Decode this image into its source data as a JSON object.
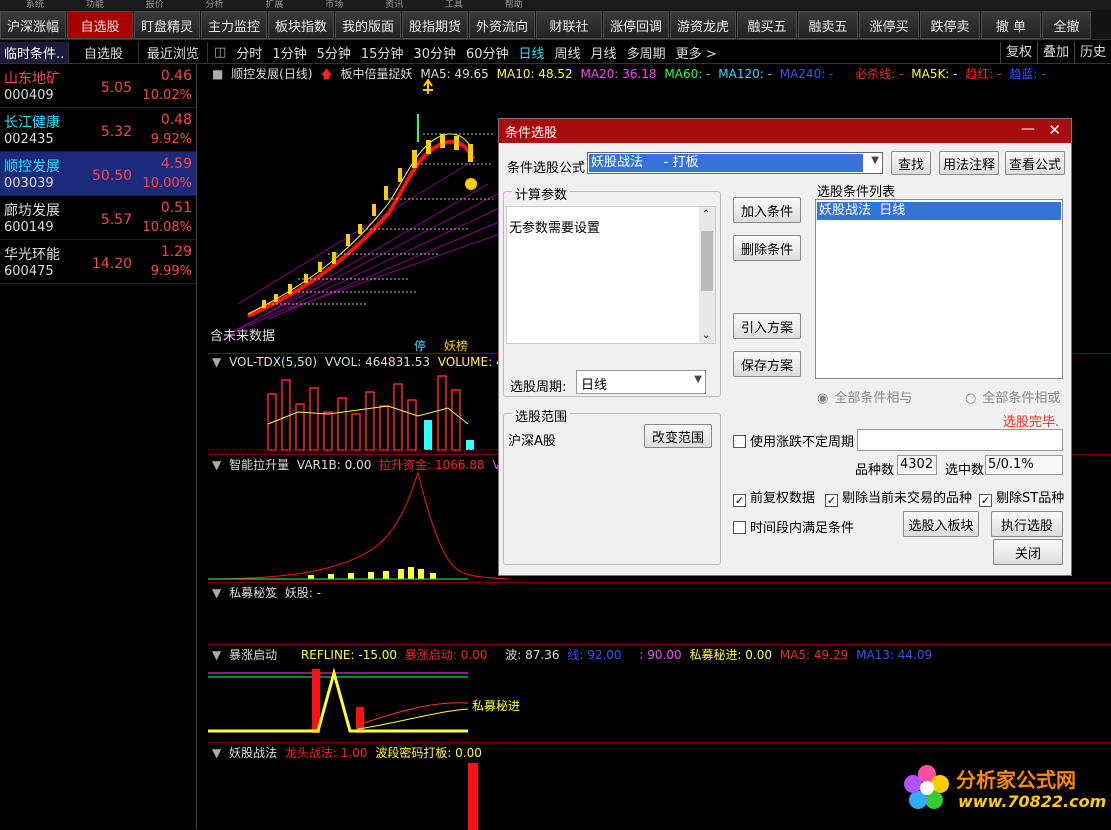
{
  "colors": {
    "up": "#ff4444",
    "accent": "#a80000",
    "cyan": "#33ddff",
    "yellow": "#ffff33",
    "magenta": "#ff44ff"
  },
  "menubar": {
    "items": [
      "系统",
      "功能",
      "报价",
      "分析",
      "扩展",
      "市场",
      "资讯",
      "工具",
      "帮助"
    ]
  },
  "toolbar": {
    "buttons": [
      "沪深涨幅",
      "自选股",
      "盯盘精灵",
      "主力监控",
      "板块指数",
      "我的版面",
      "股指期货",
      "外资流向",
      "财联社",
      "涨停回调",
      "游资龙虎",
      "融买五",
      "融卖五",
      "涨停买",
      "跌停卖",
      "撤 单",
      "全撤"
    ]
  },
  "leftTabs": [
    "临时条件..",
    "自选股",
    "最近浏览"
  ],
  "stocks": [
    {
      "name": "山东地矿",
      "code": "000409",
      "price": "5.05",
      "change": "0.46",
      "pct": "10.02%"
    },
    {
      "name": "长江健康",
      "code": "002435",
      "price": "5.32",
      "change": "0.48",
      "pct": "9.92%"
    },
    {
      "name": "顺控发展",
      "code": "003039",
      "price": "50.50",
      "change": "4.59",
      "pct": "10.00%"
    },
    {
      "name": "廊坊发展",
      "code": "600149",
      "price": "5.57",
      "change": "0.51",
      "pct": "10.08%"
    },
    {
      "name": "华光环能",
      "code": "600475",
      "price": "14.20",
      "change": "1.29",
      "pct": "9.99%"
    }
  ],
  "periods": [
    "分时",
    "1分钟",
    "5分钟",
    "15分钟",
    "30分钟",
    "60分钟",
    "日线",
    "周线",
    "月线",
    "多周期",
    "更多 >"
  ],
  "currentPeriod": "日线",
  "rightButtons": [
    "复权",
    "叠加",
    "历史"
  ],
  "mainChart": {
    "title": "顺控发展(日线)",
    "indicator": "板中倍量捉妖",
    "ma5": "MA5: 49.65",
    "ma10": "MA10: 48.52",
    "ma20": "MA20: 36.18",
    "ma60": "MA60: -",
    "ma120": "MA120: -",
    "ma240": "MA240: -",
    "extra1": "必杀线: -",
    "extra2": "MA5K: -",
    "extra3": "趋红: -",
    "extra4": "趋蓝: -",
    "future": "含未来数据",
    "tag1": "停",
    "tag2": "妖榜"
  },
  "volPane": {
    "title": "VOL-TDX(5,50)",
    "vvol": "VVOL: 464831.53",
    "volume": "VOLUME: 4"
  },
  "pane3": {
    "title": "智能拉升量",
    "var": "VAR1B: 0.00",
    "fund": "拉升资金: 1066.88",
    "tail": "VA"
  },
  "pane4": {
    "title": "私募秘笈",
    "value": "妖股: -"
  },
  "pane5": {
    "title": "暴涨启动",
    "refline": "REFLINE: -15.00",
    "start": "暴涨启动: 0.00",
    "wave": "波: 87.36",
    "v2": "线: 92.00",
    "v3": ": 90.00",
    "secret": "私募秘进: 0.00",
    "ma5": "MA5: 49.29",
    "ma13": "MA13: 44.09",
    "annot": "私募秘进"
  },
  "pane6": {
    "title": "妖股战法",
    "a": "龙头战法: 1.00",
    "b": "波段密码打板: 0.00"
  },
  "watermark": {
    "site": "www.70822.com",
    "brand": "分析家公式网"
  },
  "dialog": {
    "title": "条件选股",
    "formulaLabel": "条件选股公式",
    "formulaValue": "妖股战法     - 打板",
    "btnFind": "查找",
    "btnUsage": "用法注释",
    "btnView": "查看公式",
    "paramGroup": "计算参数",
    "paramText": "无参数需要设置",
    "btnAdd": "加入条件",
    "btnDelete": "删除条件",
    "btnImport": "引入方案",
    "btnSave": "保存方案",
    "listLabel": "选股条件列表",
    "listItems": [
      "妖股战法  日线"
    ],
    "periodLabel": "选股周期:",
    "periodValue": "日线",
    "radioAnd": "全部条件相与",
    "radioOr": "全部条件相或",
    "status": "选股完毕.",
    "rangeGroup": "选股范围",
    "rangeValue": "沪深A股",
    "btnRange": "改变范围",
    "chkVolatile": "使用涨跌不定周期",
    "countLabel": "品种数",
    "countValue": "4302",
    "hitLabel": "选中数",
    "hitValue": "5/0.1%",
    "chkAdjust": "前复权数据",
    "chkSuspend": "剔除当前未交易的品种",
    "chkST": "剔除ST品种",
    "chkPeriod": "时间段内满足条件",
    "btnToBlock": "选股入板块",
    "btnRun": "执行选股",
    "btnClose": "关闭"
  }
}
